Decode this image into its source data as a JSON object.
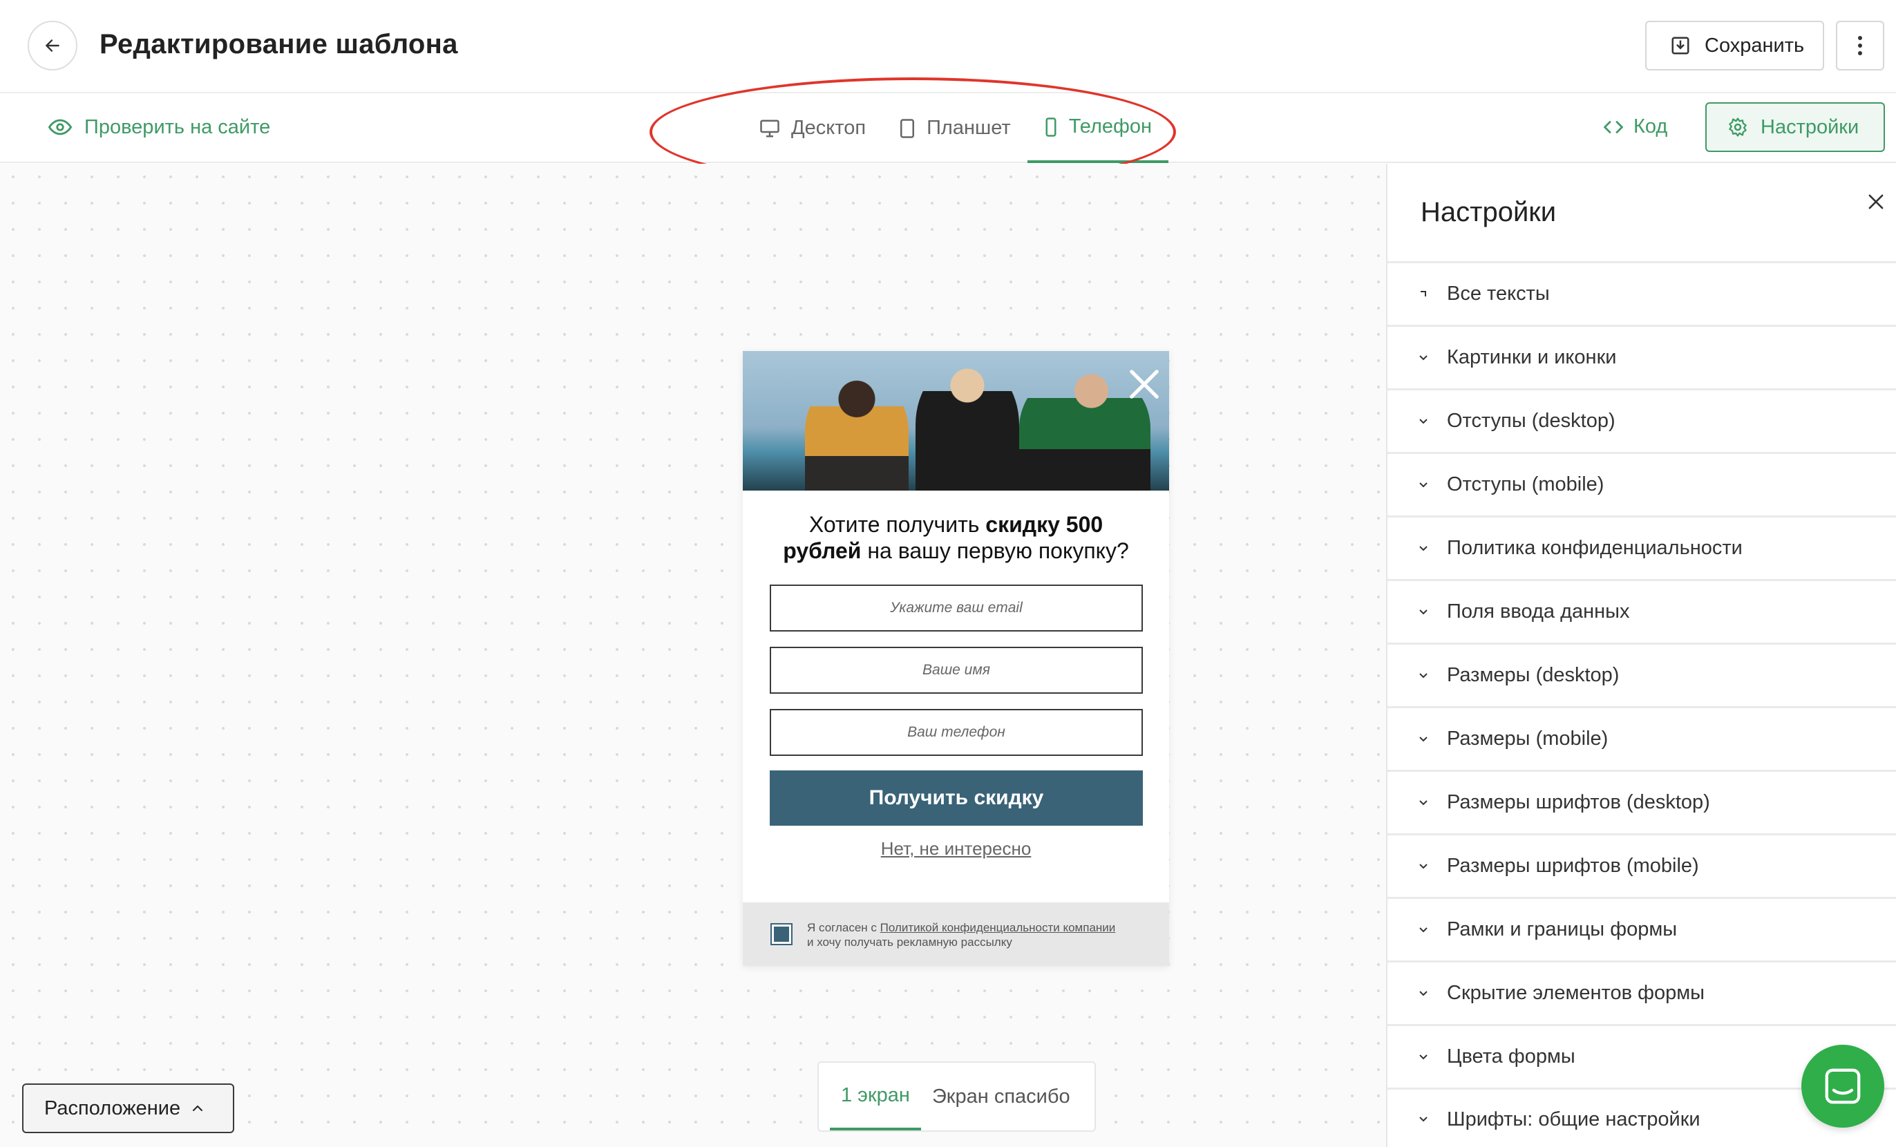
{
  "header": {
    "title": "Редактирование шаблона",
    "save_label": "Сохранить"
  },
  "toolbar": {
    "check_link": "Проверить на сайте",
    "devices": [
      {
        "label": "Десктоп",
        "icon": "desktop-icon",
        "active": false
      },
      {
        "label": "Планшет",
        "icon": "tablet-icon",
        "active": false
      },
      {
        "label": "Телефон",
        "icon": "phone-icon",
        "active": true
      }
    ],
    "code_label": "Код",
    "settings_label": "Настройки"
  },
  "popup": {
    "headline_pre": "Хотите получить ",
    "headline_bold_1": "скидку 500",
    "headline_bold_2": "рублей",
    "headline_post": " на вашу первую покупку?",
    "email_placeholder": "Укажите ваш email",
    "name_placeholder": "Ваше имя",
    "phone_placeholder": "Ваш телефон",
    "submit_label": "Получить скидку",
    "decline_label": "Нет, не интересно",
    "consent_pre": "Я согласен с ",
    "consent_link": "Политикой конфиденциальности компании",
    "consent_post": "и хочу получать рекламную рассылку",
    "consent_checked": true
  },
  "screens": {
    "tabs": [
      {
        "label": "1 экран",
        "active": true
      },
      {
        "label": "Экран спасибо",
        "active": false
      }
    ]
  },
  "layout_button": "Расположение",
  "settings_panel": {
    "title": "Настройки",
    "items": [
      "Все тексты",
      "Картинки и иконки",
      "Отступы (desktop)",
      "Отступы (mobile)",
      "Политика конфиденциальности",
      "Поля ввода данных",
      "Размеры (desktop)",
      "Размеры (mobile)",
      "Размеры шрифтов (desktop)",
      "Размеры шрифтов (mobile)",
      "Рамки и границы формы",
      "Скрытие элементов формы",
      "Цвета формы",
      "Шрифты: общие настройки"
    ]
  },
  "colors": {
    "accent": "#3f9a66",
    "submit": "#3a6378",
    "highlight": "#e0352b",
    "chat": "#2fae4a"
  }
}
